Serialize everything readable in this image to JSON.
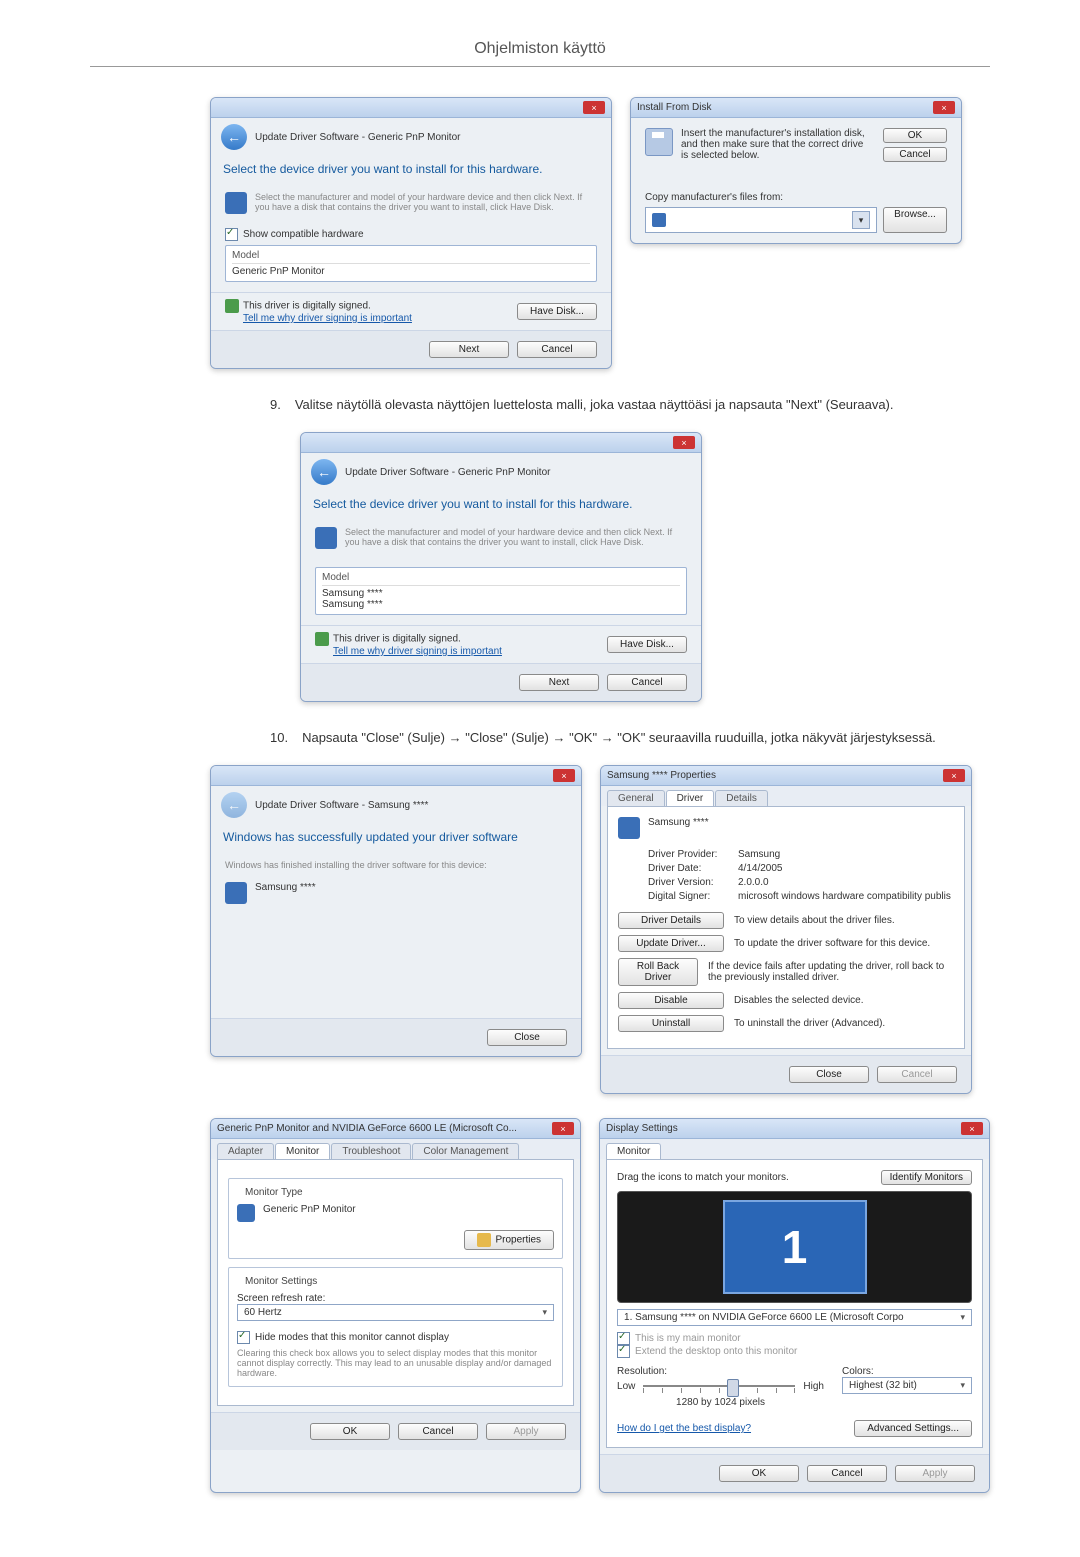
{
  "page_title": "Ohjelmiston käyttö",
  "step9": {
    "num": "9.",
    "text": "Valitse näytöllä olevasta näyttöjen luettelosta malli, joka vastaa näyttöäsi ja napsauta \"Next\" (Seuraava)."
  },
  "step10": {
    "num": "10.",
    "text": "Napsauta \"Close\" (Sulje) → \"Close\" (Sulje) → \"OK\" → \"OK\" seuraavilla ruuduilla, jotka näkyvät järjestyksessä."
  },
  "dlg1": {
    "title": "Update Driver Software - Generic PnP Monitor",
    "heading": "Select the device driver you want to install for this hardware.",
    "sub": "Select the manufacturer and model of your hardware device and then click Next. If you have a disk that contains the driver you want to install, click Have Disk.",
    "showcompat_checked": true,
    "showcompat": "Show compatible hardware",
    "model_hdr": "Model",
    "model1": "Generic PnP Monitor",
    "signed": "This driver is digitally signed.",
    "tellme": "Tell me why driver signing is important",
    "havedisk": "Have Disk...",
    "next": "Next",
    "cancel": "Cancel"
  },
  "dlg2": {
    "title": "Install From Disk",
    "msg": "Insert the manufacturer's installation disk, and then make sure that the correct drive is selected below.",
    "ok": "OK",
    "cancel": "Cancel",
    "copyfrom": "Copy manufacturer's files from:",
    "browse": "Browse..."
  },
  "dlg3": {
    "title": "Update Driver Software - Generic PnP Monitor",
    "heading": "Select the device driver you want to install for this hardware.",
    "sub": "Select the manufacturer and model of your hardware device and then click Next. If you have a disk that contains the driver you want to install, click Have Disk.",
    "model_hdr": "Model",
    "model1": "Samsung ****",
    "model2": "Samsung ****",
    "signed": "This driver is digitally signed.",
    "tellme": "Tell me why driver signing is important",
    "havedisk": "Have Disk...",
    "next": "Next",
    "cancel": "Cancel"
  },
  "dlg4": {
    "title": "Update Driver Software - Samsung ****",
    "heading": "Windows has successfully updated your driver software",
    "sub": "Windows has finished installing the driver software for this device:",
    "device": "Samsung ****",
    "close": "Close"
  },
  "dlg5": {
    "title": "Samsung **** Properties",
    "tab1": "General",
    "tab2": "Driver",
    "tab3": "Details",
    "device": "Samsung ****",
    "provider_k": "Driver Provider:",
    "provider_v": "Samsung",
    "date_k": "Driver Date:",
    "date_v": "4/14/2005",
    "version_k": "Driver Version:",
    "version_v": "2.0.0.0",
    "signer_k": "Digital Signer:",
    "signer_v": "microsoft windows hardware compatibility publis",
    "btn_details": "Driver Details",
    "txt_details": "To view details about the driver files.",
    "btn_update": "Update Driver...",
    "txt_update": "To update the driver software for this device.",
    "btn_rollback": "Roll Back Driver",
    "txt_rollback": "If the device fails after updating the driver, roll back to the previously installed driver.",
    "btn_disable": "Disable",
    "txt_disable": "Disables the selected device.",
    "btn_uninstall": "Uninstall",
    "txt_uninstall": "To uninstall the driver (Advanced).",
    "close": "Close",
    "cancel": "Cancel"
  },
  "dlg6": {
    "title": "Generic PnP Monitor and NVIDIA GeForce 6600 LE (Microsoft Co...",
    "tab1": "Adapter",
    "tab2": "Monitor",
    "tab3": "Troubleshoot",
    "tab4": "Color Management",
    "montype_legend": "Monitor Type",
    "montype_name": "Generic PnP Monitor",
    "properties": "Properties",
    "monsettings_legend": "Monitor Settings",
    "refresh_label": "Screen refresh rate:",
    "refresh_value": "60 Hertz",
    "hidemodes_checked": true,
    "hidemodes": "Hide modes that this monitor cannot display",
    "hidemodes_note": "Clearing this check box allows you to select display modes that this monitor cannot display correctly. This may lead to an unusable display and/or damaged hardware.",
    "ok": "OK",
    "cancel": "Cancel",
    "apply": "Apply"
  },
  "dlg7": {
    "title": "Display Settings",
    "tab1": "Monitor",
    "drag": "Drag the icons to match your monitors.",
    "identify": "Identify Monitors",
    "monlist": "1. Samsung **** on NVIDIA GeForce 6600 LE (Microsoft Corpo",
    "thisismain": "This is my main monitor",
    "extend": "Extend the desktop onto this monitor",
    "res_label": "Resolution:",
    "low": "Low",
    "high": "High",
    "res_value": "1280 by 1024 pixels",
    "colors_label": "Colors:",
    "colors_value": "Highest (32 bit)",
    "howdo": "How do I get the best display?",
    "advanced": "Advanced Settings...",
    "ok": "OK",
    "cancel": "Cancel",
    "apply": "Apply"
  }
}
